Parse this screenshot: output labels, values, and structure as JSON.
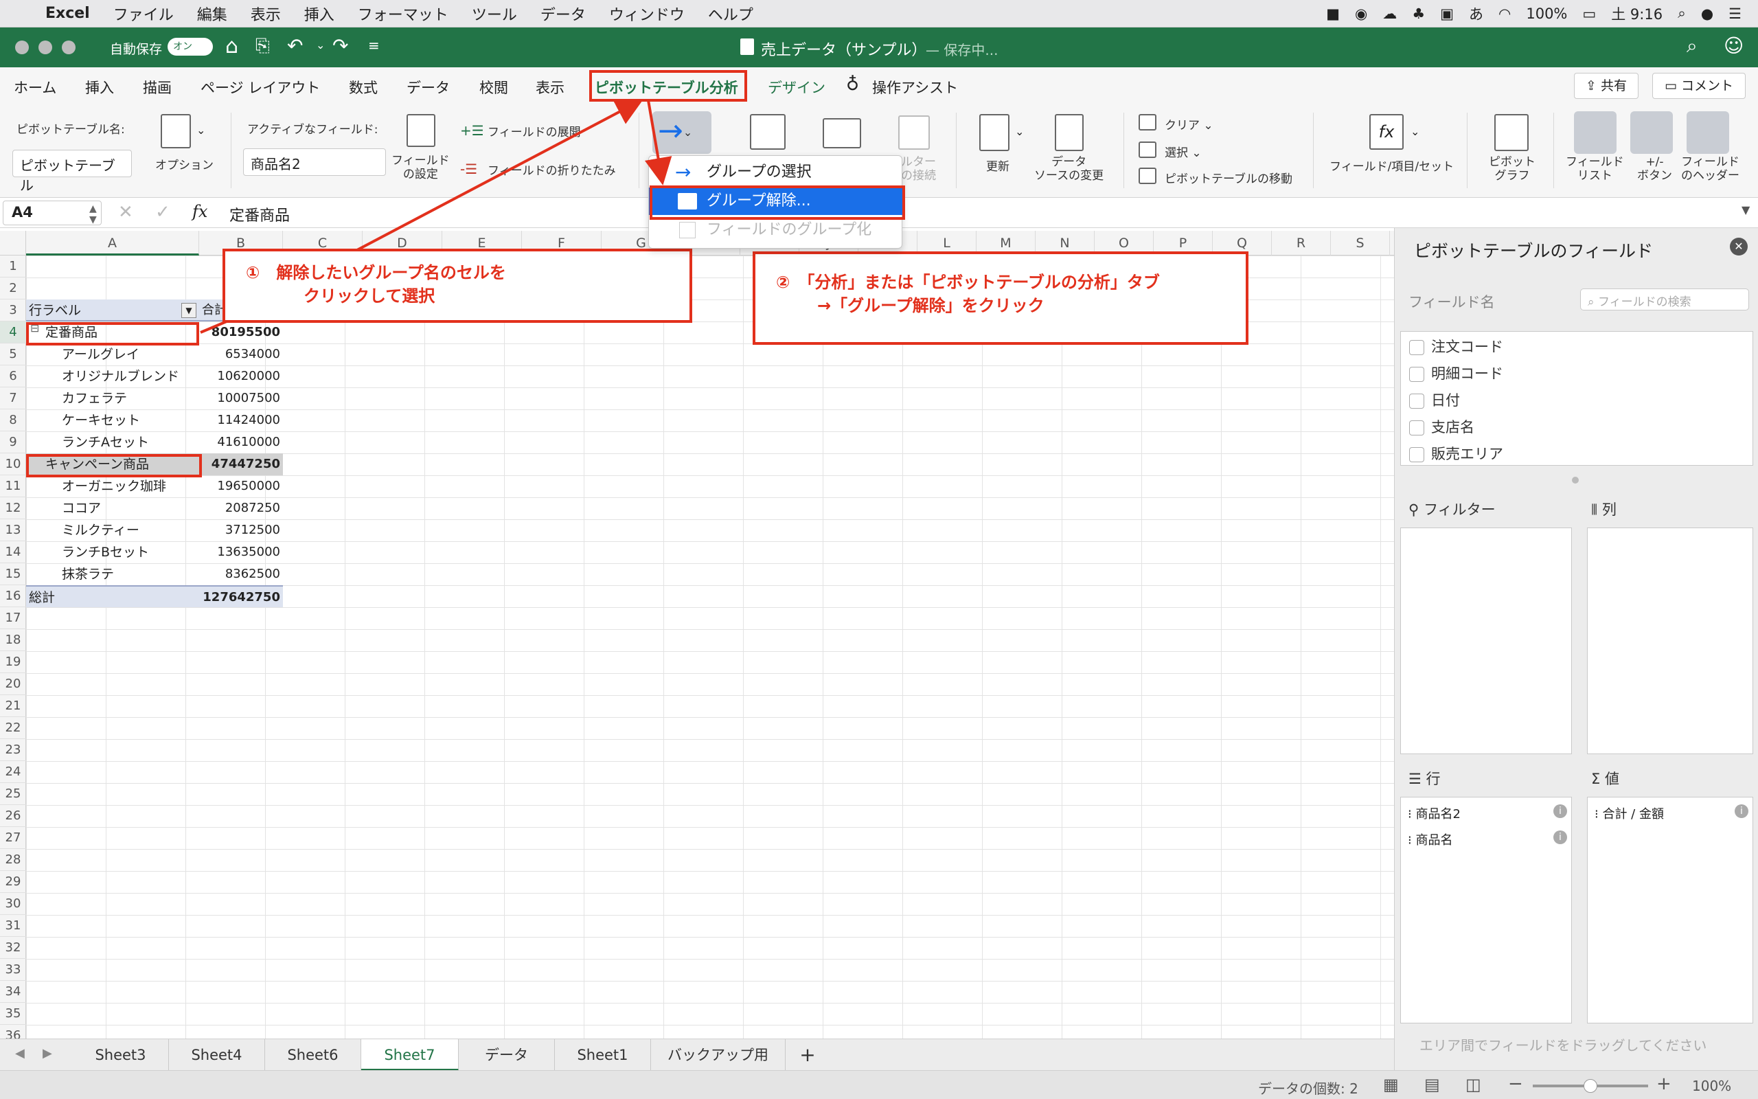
{
  "menubar": {
    "app": "Excel",
    "items": [
      "ファイル",
      "編集",
      "表示",
      "挿入",
      "フォーマット",
      "ツール",
      "データ",
      "ウィンドウ",
      "ヘルプ"
    ],
    "battery": "100%",
    "input_mode": "あ",
    "clock": "土 9:16"
  },
  "titlebar": {
    "autosave_label": "自動保存",
    "autosave_state": "オン",
    "doc_title": "売上データ（サンプル）",
    "doc_status": "— 保存中..."
  },
  "tabs": {
    "items": [
      "ホーム",
      "挿入",
      "描画",
      "ページ レイアウト",
      "数式",
      "データ",
      "校閲",
      "表示",
      "ピボットテーブル分析",
      "デザイン",
      "操作アシスト"
    ],
    "active": "ピボットテーブル分析",
    "share": "共有",
    "comment": "コメント"
  },
  "ribbon": {
    "pt_name_label": "ピボットテーブル名:",
    "pt_name_value": "ピボットテーブル",
    "options": "オプション",
    "active_field_label": "アクティブなフィールド:",
    "active_field_value": "商品名2",
    "field_settings": "フィールド\nの設定",
    "expand": "フィールドの展開",
    "collapse": "フィールドの折りたたみ",
    "filter_conn": "ルター\nの接続",
    "refresh": "更新",
    "data_source": "データ\nソースの変更",
    "clear": "クリア",
    "select": "選択",
    "move_pt": "ピボットテーブルの移動",
    "fields_items": "フィールド/項目/セット",
    "pivot_chart": "ピボット\nグラフ",
    "field_list": "フィールド\nリスト",
    "buttons": "+/-\nボタン",
    "field_headers": "フィールド\nのヘッダー"
  },
  "dropdown": {
    "items": [
      "グループの選択",
      "グループ解除...",
      "フィールドのグループ化"
    ]
  },
  "formula": {
    "cell_ref": "A4",
    "fx": "fx",
    "content": "定番商品"
  },
  "columns": [
    "A",
    "B",
    "C",
    "D",
    "E",
    "F",
    "G",
    "H",
    "I",
    "J",
    "K",
    "L",
    "M",
    "N",
    "O",
    "P",
    "Q",
    "R",
    "S"
  ],
  "rows": [
    "1",
    "2",
    "3",
    "4",
    "5",
    "6",
    "7",
    "8",
    "9",
    "10",
    "11",
    "12",
    "13",
    "14",
    "15",
    "16",
    "17",
    "18",
    "19",
    "20",
    "21",
    "22",
    "23",
    "24",
    "25",
    "26",
    "27",
    "28",
    "29",
    "30",
    "31",
    "32",
    "33",
    "34",
    "35",
    "36"
  ],
  "pivot": {
    "row_label": "行ラベル",
    "value_header": "合計",
    "data": [
      {
        "label": "定番商品",
        "value": "80195500",
        "group": true
      },
      {
        "label": "アールグレイ",
        "value": "6534000"
      },
      {
        "label": "オリジナルブレンド",
        "value": "10620000"
      },
      {
        "label": "カフェラテ",
        "value": "10007500"
      },
      {
        "label": "ケーキセット",
        "value": "11424000"
      },
      {
        "label": "ランチAセット",
        "value": "41610000"
      },
      {
        "label": "キャンペーン商品",
        "value": "47447250",
        "group": true
      },
      {
        "label": "オーガニック珈琲",
        "value": "19650000"
      },
      {
        "label": "ココア",
        "value": "2087250"
      },
      {
        "label": "ミルクティー",
        "value": "3712500"
      },
      {
        "label": "ランチBセット",
        "value": "13635000"
      },
      {
        "label": "抹茶ラテ",
        "value": "8362500"
      },
      {
        "label": "総計",
        "value": "127642750",
        "total": true
      }
    ]
  },
  "annotations": {
    "step1_line1": "①　解除したいグループ名のセルを",
    "step1_line2": "クリックして選択",
    "step2_line1": "②　「分析」または「ピボットテーブルの分析」タブ",
    "step2_line2": "→「グループ解除」をクリック"
  },
  "pane": {
    "title": "ピボットテーブルのフィールド",
    "field_name_label": "フィールド名",
    "search_placeholder": "フィールドの検索",
    "fields": [
      "注文コード",
      "明細コード",
      "日付",
      "支店名",
      "販売エリア"
    ],
    "filter": "フィルター",
    "columns": "列",
    "rows": "行",
    "values": "値",
    "row_items": [
      "商品名2",
      "商品名"
    ],
    "value_items": [
      "合計 / 金額"
    ],
    "hint": "エリア間でフィールドをドラッグしてください"
  },
  "sheets": {
    "items": [
      "Sheet3",
      "Sheet4",
      "Sheet6",
      "Sheet7",
      "データ",
      "Sheet1",
      "バックアップ用"
    ],
    "active": "Sheet7",
    "add": "+"
  },
  "status": {
    "count": "データの個数: 2",
    "zoom": "100%"
  },
  "colors": {
    "excel_green": "#227447",
    "accent_red": "#e2301c",
    "selection_blue": "#1a6fe8"
  }
}
